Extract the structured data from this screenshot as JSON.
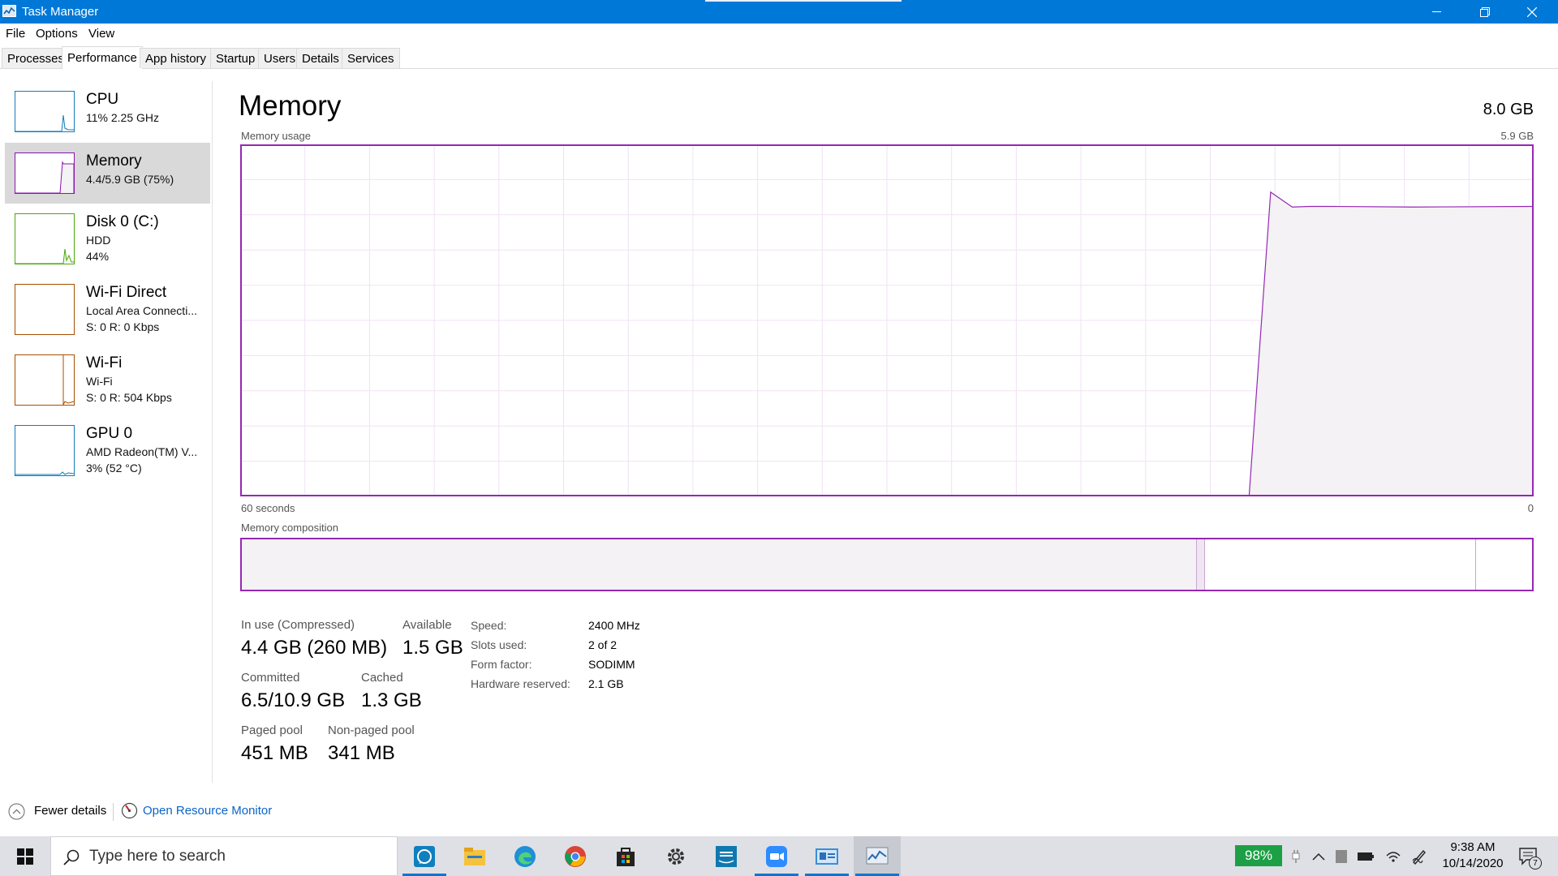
{
  "window": {
    "title": "Task Manager",
    "accent_color": "#0078d7",
    "memory_color": "#9528b4"
  },
  "menu": {
    "items": [
      "File",
      "Options",
      "View"
    ]
  },
  "tabs": [
    "Processes",
    "Performance",
    "App history",
    "Startup",
    "Users",
    "Details",
    "Services"
  ],
  "active_tab": "Performance",
  "sidebar": {
    "items": [
      {
        "name": "CPU",
        "lines": [
          "11%  2.25 GHz"
        ],
        "color": "#117dbb"
      },
      {
        "name": "Memory",
        "lines": [
          "4.4/5.9 GB (75%)"
        ],
        "color": "#8b12ae"
      },
      {
        "name": "Disk 0 (C:)",
        "lines": [
          "HDD",
          "44%"
        ],
        "color": "#4da60c"
      },
      {
        "name": "Wi-Fi Direct",
        "lines": [
          "Local Area Connecti...",
          "S: 0  R: 0 Kbps"
        ],
        "color": "#a74f01"
      },
      {
        "name": "Wi-Fi",
        "lines": [
          "Wi-Fi",
          "S: 0  R: 504 Kbps"
        ],
        "color": "#a74f01"
      },
      {
        "name": "GPU 0",
        "lines": [
          "AMD Radeon(TM) V...",
          "3%  (52 °C)"
        ],
        "color": "#117dbb"
      }
    ],
    "selected": "Memory"
  },
  "main": {
    "title": "Memory",
    "total": "8.0 GB",
    "usage_label": "Memory usage",
    "usage_max": "5.9 GB",
    "time_left": "60 seconds",
    "time_right": "0",
    "composition_label": "Memory composition"
  },
  "chart_data": {
    "type": "area",
    "title": "Memory usage",
    "xlabel": "",
    "ylabel": "",
    "x_range_seconds": [
      60,
      0
    ],
    "ylim": [
      0,
      5.9
    ],
    "unit": "GB",
    "series": [
      {
        "values_seconds_ago": [
          60,
          13.2,
          12.2,
          11.2,
          10.4,
          9.3,
          5.6,
          0
        ],
        "values": [
          0,
          0,
          5.1,
          4.85,
          4.86,
          4.86,
          4.85,
          4.86
        ]
      }
    ],
    "grid": true
  },
  "composition": {
    "in_use_fraction": 0.74,
    "modified_fraction": 0.006,
    "standby_fraction": 0.21,
    "free_fraction": 0.04
  },
  "stats": {
    "in_use_label": "In use (Compressed)",
    "in_use_value": "4.4 GB (260 MB)",
    "available_label": "Available",
    "available_value": "1.5 GB",
    "committed_label": "Committed",
    "committed_value": "6.5/10.9 GB",
    "cached_label": "Cached",
    "cached_value": "1.3 GB",
    "paged_label": "Paged pool",
    "paged_value": "451 MB",
    "nonpaged_label": "Non-paged pool",
    "nonpaged_value": "341 MB"
  },
  "specs": [
    {
      "label": "Speed:",
      "value": "2400 MHz"
    },
    {
      "label": "Slots used:",
      "value": "2 of 2"
    },
    {
      "label": "Form factor:",
      "value": "SODIMM"
    },
    {
      "label": "Hardware reserved:",
      "value": "2.1 GB"
    }
  ],
  "footer": {
    "fewer_details": "Fewer details",
    "resource_monitor": "Open Resource Monitor"
  },
  "taskbar": {
    "search_placeholder": "Type here to search",
    "apps": [
      "whatsapp-icon",
      "file-explorer-icon",
      "edge-icon",
      "chrome-icon",
      "store-icon",
      "settings-icon",
      "prime-video-icon",
      "zoom-icon",
      "control-panel-icon",
      "task-manager-icon"
    ],
    "battery": "98%",
    "time": "9:38 AM",
    "date": "10/14/2020",
    "notification_count": "7"
  }
}
